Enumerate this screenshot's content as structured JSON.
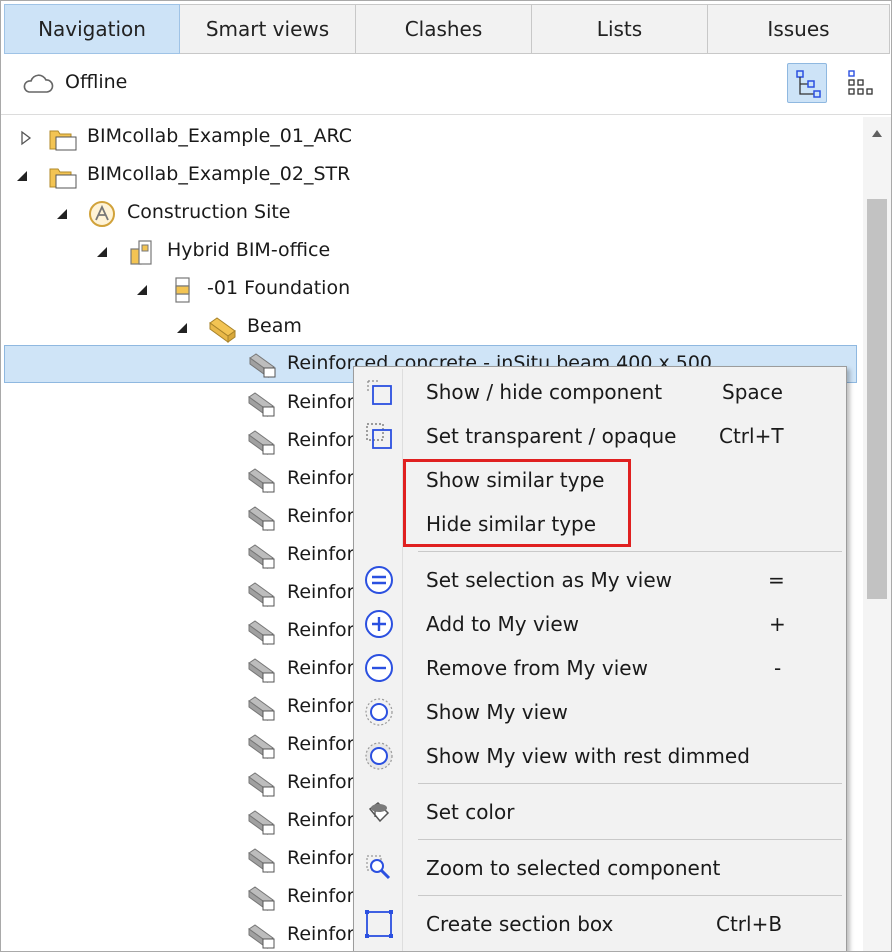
{
  "tabs": [
    {
      "label": "Navigation",
      "active": true
    },
    {
      "label": "Smart views",
      "active": false
    },
    {
      "label": "Clashes",
      "active": false
    },
    {
      "label": "Lists",
      "active": false
    },
    {
      "label": "Issues",
      "active": false
    }
  ],
  "status": {
    "text": "Offline",
    "icon": "cloud-icon"
  },
  "view_buttons": [
    {
      "name": "tree-view-button",
      "icon": "tree-view-icon",
      "active": true
    },
    {
      "name": "flat-view-button",
      "icon": "flat-view-icon",
      "active": false
    }
  ],
  "tree": {
    "root1": "BIMcollab_Example_01_ARC",
    "root2": "BIMcollab_Example_02_STR",
    "site": "Construction Site",
    "building": "Hybrid BIM-office",
    "storey": "-01 Foundation",
    "type": "Beam",
    "selected_item": "Reinforced concrete - inSitu beam 400 x 500",
    "item": "Reinforced concrete - inSitu beam 400 x 500"
  },
  "context_menu": {
    "items": [
      {
        "label": "Show / hide component",
        "shortcut": "Space",
        "icon": "show-hide-icon"
      },
      {
        "label": "Set transparent / opaque",
        "shortcut": "Ctrl+T",
        "icon": "transparent-icon"
      },
      {
        "label": "Show similar type",
        "shortcut": ""
      },
      {
        "label": "Hide similar type",
        "shortcut": ""
      },
      {
        "label": "Set selection as My view",
        "shortcut": "=",
        "icon": "equals-circle-icon"
      },
      {
        "label": "Add to My view",
        "shortcut": "+",
        "icon": "plus-circle-icon"
      },
      {
        "label": "Remove from My view",
        "shortcut": "-",
        "icon": "minus-circle-icon"
      },
      {
        "label": "Show My view",
        "shortcut": "",
        "icon": "dotted-circle-icon"
      },
      {
        "label": "Show My view with rest dimmed",
        "shortcut": "",
        "icon": "dimmed-circle-icon"
      },
      {
        "label": "Set color",
        "shortcut": "",
        "icon": "paint-bucket-icon"
      },
      {
        "label": "Zoom to selected component",
        "shortcut": "",
        "icon": "zoom-icon"
      },
      {
        "label": "Create section box",
        "shortcut": "Ctrl+B",
        "icon": "section-box-icon"
      }
    ]
  },
  "colors": {
    "accent": "#2b50e0",
    "highlight": "#e02020",
    "selection": "#cfe4f7",
    "folder": "#f3c453"
  }
}
